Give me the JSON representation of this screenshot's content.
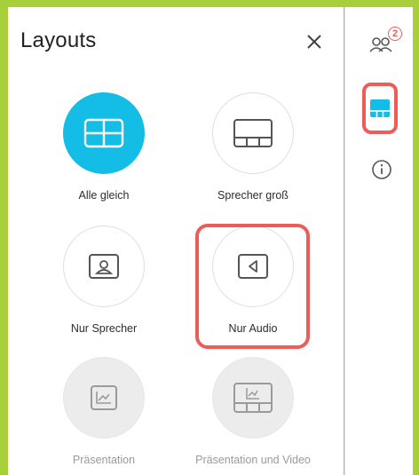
{
  "panel": {
    "title": "Layouts",
    "close_icon": "close-icon"
  },
  "layouts": [
    {
      "label": "Alle gleich",
      "icon": "grid-layout-icon",
      "state": "selected"
    },
    {
      "label": "Sprecher groß",
      "icon": "prominent-speaker-icon",
      "state": "normal"
    },
    {
      "label": "Nur Sprecher",
      "icon": "single-speaker-icon",
      "state": "normal"
    },
    {
      "label": "Nur Audio",
      "icon": "audio-only-icon",
      "state": "highlighted"
    },
    {
      "label": "Präsentation",
      "icon": "presentation-icon",
      "state": "disabled"
    },
    {
      "label": "Präsentation und Video",
      "icon": "presentation-video-icon",
      "state": "disabled"
    }
  ],
  "sidebar": {
    "participants_icon": "participants-icon",
    "participants_count": "2",
    "layout_icon": "layout-icon",
    "info_icon": "info-icon"
  },
  "colors": {
    "frame": "#a7cf3a",
    "accent": "#14bde6",
    "highlight": "#ec5d57"
  }
}
